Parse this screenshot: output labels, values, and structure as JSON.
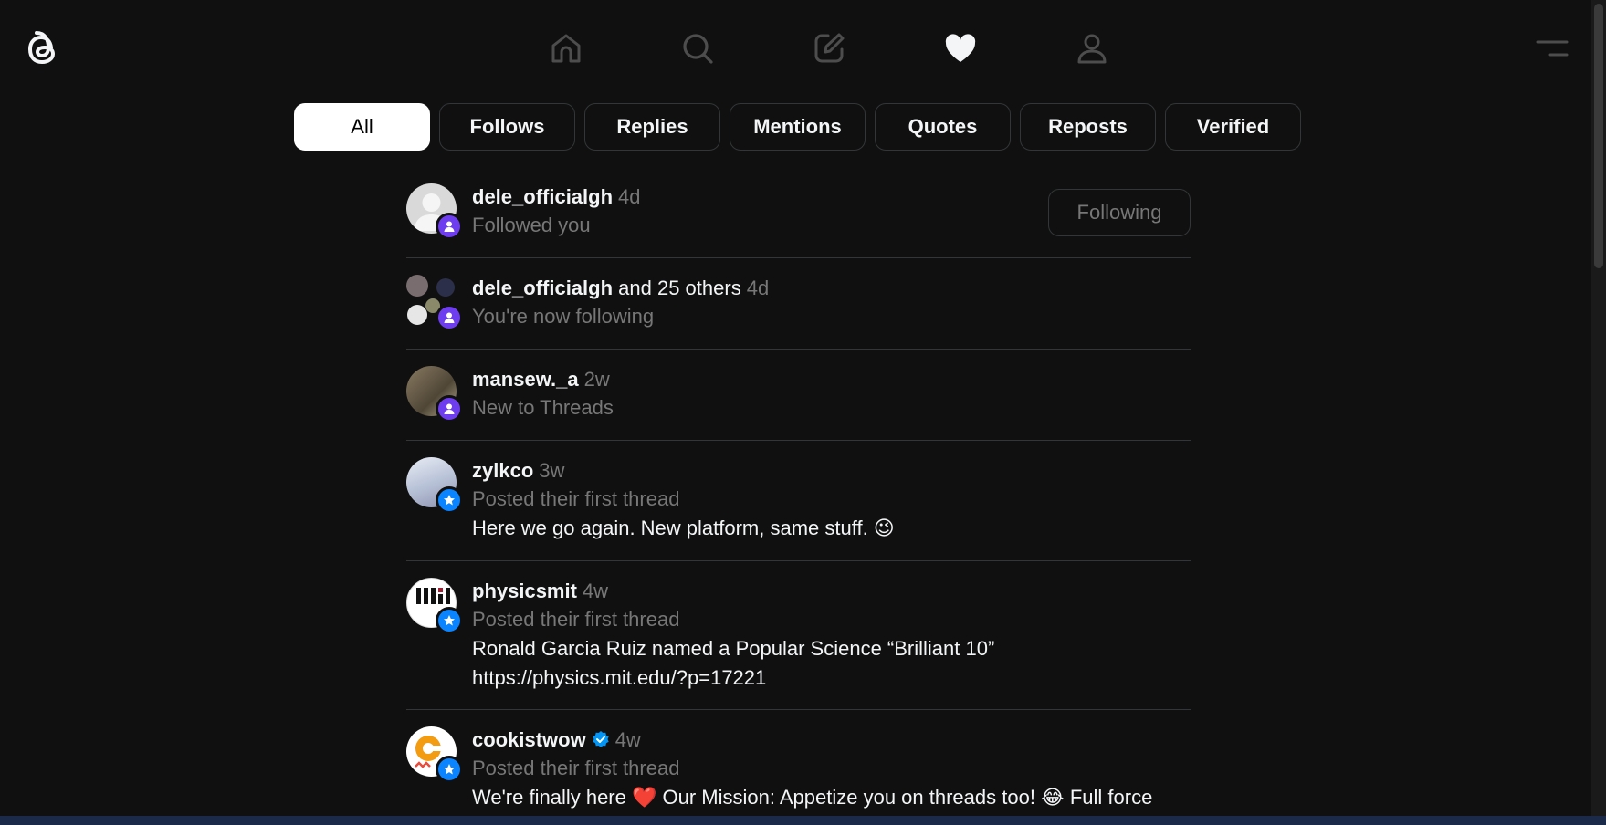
{
  "nav": {
    "items": [
      {
        "name": "home",
        "icon": "home-icon"
      },
      {
        "name": "search",
        "icon": "search-icon"
      },
      {
        "name": "create",
        "icon": "compose-icon"
      },
      {
        "name": "activity",
        "icon": "heart-icon"
      },
      {
        "name": "profile",
        "icon": "user-icon"
      }
    ],
    "active": "activity"
  },
  "tabs": [
    "All",
    "Follows",
    "Replies",
    "Mentions",
    "Quotes",
    "Reposts",
    "Verified"
  ],
  "active_tab": "All",
  "feed": [
    {
      "username": "dele_officialgh",
      "rest": "",
      "time": "4d",
      "sub": "Followed you",
      "body": [],
      "badge": "follow",
      "action": "Following"
    },
    {
      "username": "dele_officialgh",
      "rest": " and 25 others",
      "time": "4d",
      "sub": "You're now following",
      "body": [],
      "badge": "follow"
    },
    {
      "username": "mansew._a",
      "rest": "",
      "time": "2w",
      "sub": "New to Threads",
      "body": [],
      "badge": "follow"
    },
    {
      "username": "zylkco",
      "rest": "",
      "time": "3w",
      "sub": "Posted their first thread",
      "body": [
        "Here we go again. New platform, same stuff. 😉"
      ],
      "badge": "star"
    },
    {
      "username": "physicsmit",
      "rest": "",
      "time": "4w",
      "sub": "Posted their first thread",
      "body": [
        "Ronald Garcia Ruiz named a Popular Science “Brilliant 10”",
        "https://physics.mit.edu/?p=17221"
      ],
      "badge": "star"
    },
    {
      "username": "cookistwow",
      "rest": "",
      "time": "4w",
      "sub": "Posted their first thread",
      "body": [
        "We're finally here ❤️ Our Mission: Appetize you on threads too! 😂 Full force"
      ],
      "badge": "star",
      "verified": true
    }
  ],
  "colors": {
    "background": "#101010",
    "follow_badge": "#6e3def",
    "star_badge": "#0a84ff",
    "muted_text": "#777777",
    "divider": "#333638"
  }
}
